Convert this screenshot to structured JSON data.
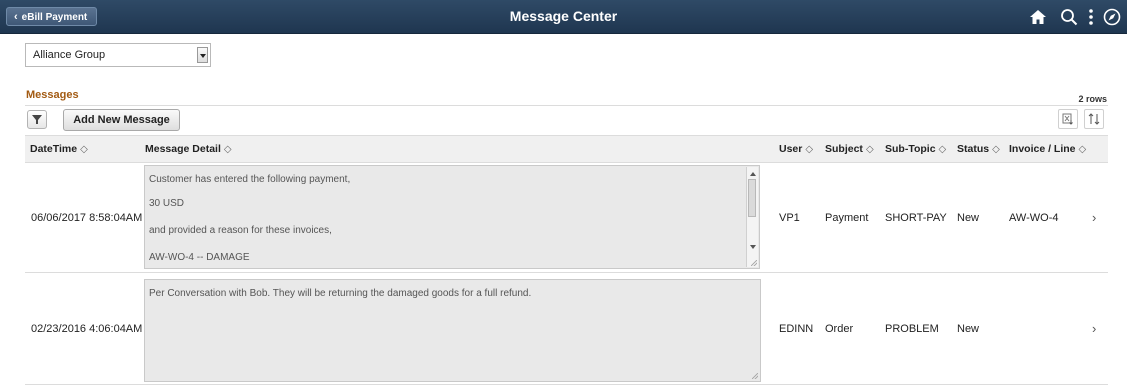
{
  "banner": {
    "back_label": "eBill Payment",
    "title": "Message Center",
    "icons": [
      "home-icon",
      "search-icon",
      "actions-menu-icon",
      "navbar-icon"
    ]
  },
  "business_unit": {
    "selected": "Alliance Group"
  },
  "grid": {
    "title": "Messages",
    "row_count": "2 rows",
    "add_button": "Add New Message",
    "columns": [
      "DateTime",
      "Message Detail",
      "User",
      "Subject",
      "Sub-Topic",
      "Status",
      "Invoice / Line"
    ],
    "rows": [
      {
        "datetime": "06/06/2017  8:58:04AM",
        "detail": [
          "Customer has entered the following payment,",
          "30  USD",
          "and provided a reason for these invoices,",
          "AW-WO-4 -- DAMAGE"
        ],
        "user": "VP1",
        "subject": "Payment",
        "subtopic": "SHORT-PAY",
        "status": "New",
        "invoice": "AW-WO-4"
      },
      {
        "datetime": "02/23/2016  4:06:04AM",
        "detail": [
          "Per Conversation with Bob.  They will be returning the damaged goods for a full refund."
        ],
        "user": "EDINN",
        "subject": "Order",
        "subtopic": "PROBLEM",
        "status": "New",
        "invoice": ""
      }
    ]
  },
  "colors": {
    "banner": "#2f4a66",
    "grid_title": "#a25a12",
    "header_bg": "#f0f0f0",
    "message_bg": "#e9e9e9"
  }
}
